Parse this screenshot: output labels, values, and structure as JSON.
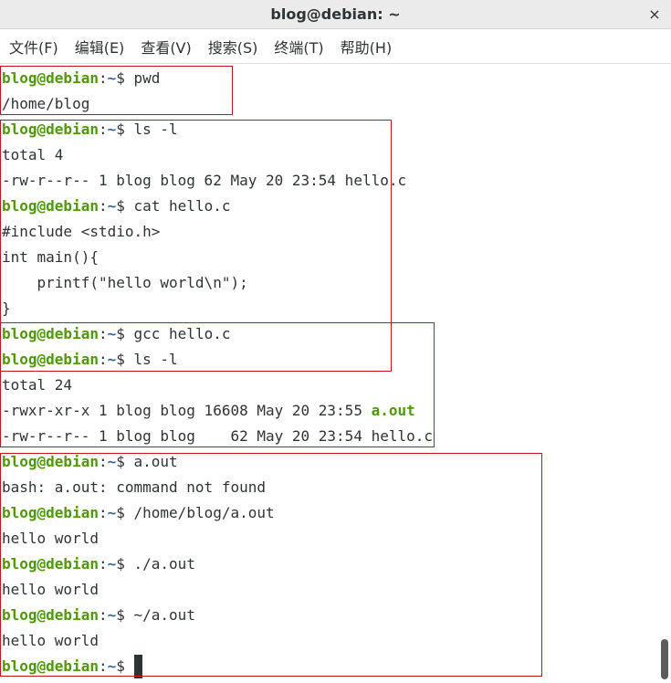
{
  "window": {
    "title": "blog@debian: ~",
    "close_glyph": "×"
  },
  "menu": [
    "文件(F)",
    "编辑(E)",
    "查看(V)",
    "搜索(S)",
    "终端(T)",
    "帮助(H)"
  ],
  "prompt": {
    "user": "blog@debian",
    "colon": ":",
    "path": "~",
    "sym": "$ "
  },
  "lines": {
    "l0_cmd": "pwd",
    "l1": "/home/blog",
    "l2_cmd": "ls -l",
    "l3": "total 4",
    "l4": "-rw-r--r-- 1 blog blog 62 May 20 23:54 hello.c",
    "l5_cmd": "cat hello.c",
    "l6": "#include <stdio.h>",
    "l7": "int main(){",
    "l8": "    printf(\"hello world\\n\");",
    "l9": "}",
    "l10_cmd": "gcc hello.c",
    "l11_cmd": "ls -l",
    "l12": "total 24",
    "l13_pre": "-rwxr-xr-x 1 blog blog 16608 May 20 23:55 ",
    "l13_file": "a.out",
    "l14": "-rw-r--r-- 1 blog blog    62 May 20 23:54 hello.c",
    "l15_cmd": "a.out",
    "l16": "bash: a.out: command not found",
    "l17_cmd": "/home/blog/a.out",
    "l18": "hello world",
    "l19_cmd": "./a.out",
    "l20": "hello world",
    "l21_cmd": "~/a.out",
    "l22": "hello world"
  }
}
